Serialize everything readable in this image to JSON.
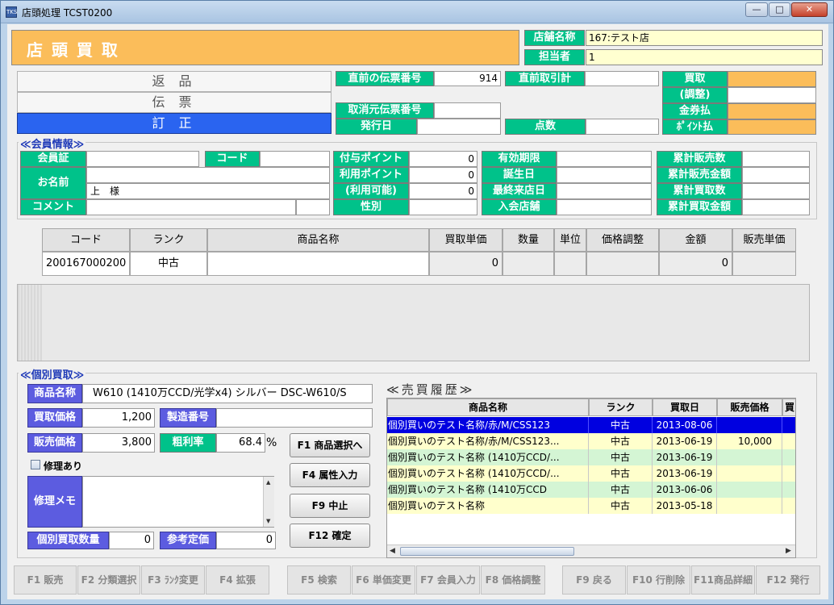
{
  "window": {
    "title": "店頭処理 TCST0200",
    "icon_text": "TKS",
    "min": "—",
    "max": "□",
    "close": "✕"
  },
  "header": {
    "title": "店 頭 買 取",
    "store_label": "店舗名称",
    "store_value": "167:テスト店",
    "staff_label": "担当者",
    "staff_value": "1"
  },
  "mode_buttons": [
    {
      "label": "返 品"
    },
    {
      "label": "伝 票"
    },
    {
      "label": "訂 正"
    }
  ],
  "slip": {
    "prev_slip_label": "直前の伝票番号",
    "prev_slip_value": "914",
    "prev_trade_label": "直前取引計",
    "prev_trade_value": "",
    "cancel_slip_label": "取消元伝票番号",
    "cancel_slip_value": "",
    "issue_date_label": "発行日",
    "issue_date_value": "",
    "points_label": "点数",
    "points_value": ""
  },
  "summary": [
    {
      "label": "買取"
    },
    {
      "label": "(調整)"
    },
    {
      "label": "金券払"
    },
    {
      "label": "ﾎﾟｲﾝﾄ払"
    }
  ],
  "member": {
    "title": "≪会員情報≫",
    "card_label": "会員証",
    "card_value": "",
    "code_label": "コード",
    "code_value": "",
    "name_label": "お名前",
    "name_value": "",
    "name_suffix": "上　様",
    "comment_label": "コメント",
    "comment_value": "",
    "points": [
      {
        "label": "付与ポイント",
        "value": "0"
      },
      {
        "label": "利用ポイント",
        "value": "0"
      },
      {
        "label": "(利用可能)",
        "value": "0"
      },
      {
        "label": "性別",
        "value": ""
      }
    ],
    "dates": [
      {
        "label": "有効期限",
        "value": ""
      },
      {
        "label": "誕生日",
        "value": ""
      },
      {
        "label": "最終来店日",
        "value": ""
      },
      {
        "label": "入会店舗",
        "value": ""
      }
    ],
    "totals": [
      {
        "label": "累計販売数",
        "value": ""
      },
      {
        "label": "累計販売金額",
        "value": ""
      },
      {
        "label": "累計買取数",
        "value": ""
      },
      {
        "label": "累計買取金額",
        "value": ""
      }
    ]
  },
  "grid": {
    "headers": [
      "コード",
      "ランク",
      "商品名称",
      "買取単価",
      "数量",
      "単位",
      "価格調整",
      "金額",
      "販売単価"
    ],
    "row": [
      "200167000200",
      "中古",
      "",
      "0",
      "",
      "",
      "",
      "0",
      ""
    ]
  },
  "individual": {
    "title": "≪個別買取≫",
    "product_label": "商品名称",
    "product_value": "W610 (1410万CCD/光学x4) シルバー DSC-W610/S",
    "buy_price_label": "買取価格",
    "buy_price_value": "1,200",
    "serial_label": "製造番号",
    "serial_value": "",
    "sell_price_label": "販売価格",
    "sell_price_value": "3,800",
    "margin_label": "粗利率",
    "margin_value": "68.4",
    "margin_unit": "%",
    "repair_label": "修理あり",
    "memo_label": "修理メモ",
    "memo_value": "",
    "qty_label": "個別買取数量",
    "qty_value": "0",
    "ref_price_label": "参考定価",
    "ref_price_value": "0",
    "buttons": [
      "F1 商品選択へ",
      "F4 属性入力",
      "F9 中止",
      "F12 確定"
    ]
  },
  "history": {
    "title": "≪売買履歴≫",
    "headers": [
      "商品名称",
      "ランク",
      "買取日",
      "販売価格",
      "買"
    ],
    "rows": [
      {
        "name": "個別買いのテスト名称/赤/M/CSS123",
        "rank": "中古",
        "date": "2013-08-06",
        "price": "",
        "selected": true
      },
      {
        "name": "個別買いのテスト名称/赤/M/CSS123...",
        "rank": "中古",
        "date": "2013-06-19",
        "price": "10,000",
        "selected": false
      },
      {
        "name": "個別買いのテスト名称 (1410万CCD/...",
        "rank": "中古",
        "date": "2013-06-19",
        "price": "",
        "selected": false
      },
      {
        "name": "個別買いのテスト名称 (1410万CCD/...",
        "rank": "中古",
        "date": "2013-06-19",
        "price": "",
        "selected": false
      },
      {
        "name": "個別買いのテスト名称 (1410万CCD",
        "rank": "中古",
        "date": "2013-06-06",
        "price": "",
        "selected": false
      },
      {
        "name": "個別買いのテスト名称",
        "rank": "中古",
        "date": "2013-05-18",
        "price": "",
        "selected": false
      }
    ],
    "scroll_left": "◀",
    "scroll_right": "▶"
  },
  "fkeys": [
    "F1 販売",
    "F2 分類選択",
    "F3 ﾗﾝｸ変更",
    "F4 拡張",
    "F5 検索",
    "F6 単価変更",
    "F7 会員入力",
    "F8 価格調整",
    "F9 戻る",
    "F10 行削除",
    "F11商品詳細",
    "F12 発行"
  ],
  "colors": {
    "green": "#00c28a",
    "orange": "#fbbd5a",
    "purple": "#5c5ce0",
    "selected": "#0000e0"
  }
}
